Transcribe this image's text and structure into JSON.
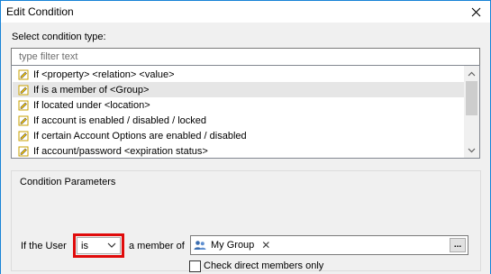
{
  "window": {
    "title": "Edit Condition"
  },
  "condition_type": {
    "label": "Select condition type:",
    "filter_placeholder": "type filter text",
    "items": [
      {
        "label": "If <property> <relation> <value>",
        "selected": false
      },
      {
        "label": "If is a member of <Group>",
        "selected": true
      },
      {
        "label": "If located under <location>",
        "selected": false
      },
      {
        "label": "If account is enabled / disabled / locked",
        "selected": false
      },
      {
        "label": "If certain Account Options are enabled / disabled",
        "selected": false
      },
      {
        "label": "If account/password <expiration status>",
        "selected": false
      }
    ]
  },
  "parameters": {
    "title": "Condition Parameters",
    "prefix_label": "If the User",
    "relation_value": "is",
    "member_label": "a member of",
    "group_chip": "My Group",
    "browse_label": "...",
    "check_direct_label": "Check direct members only"
  },
  "colors": {
    "highlight": "#e00b0b",
    "selected_row": "#e6e6e6",
    "window_border": "#1883d7"
  }
}
